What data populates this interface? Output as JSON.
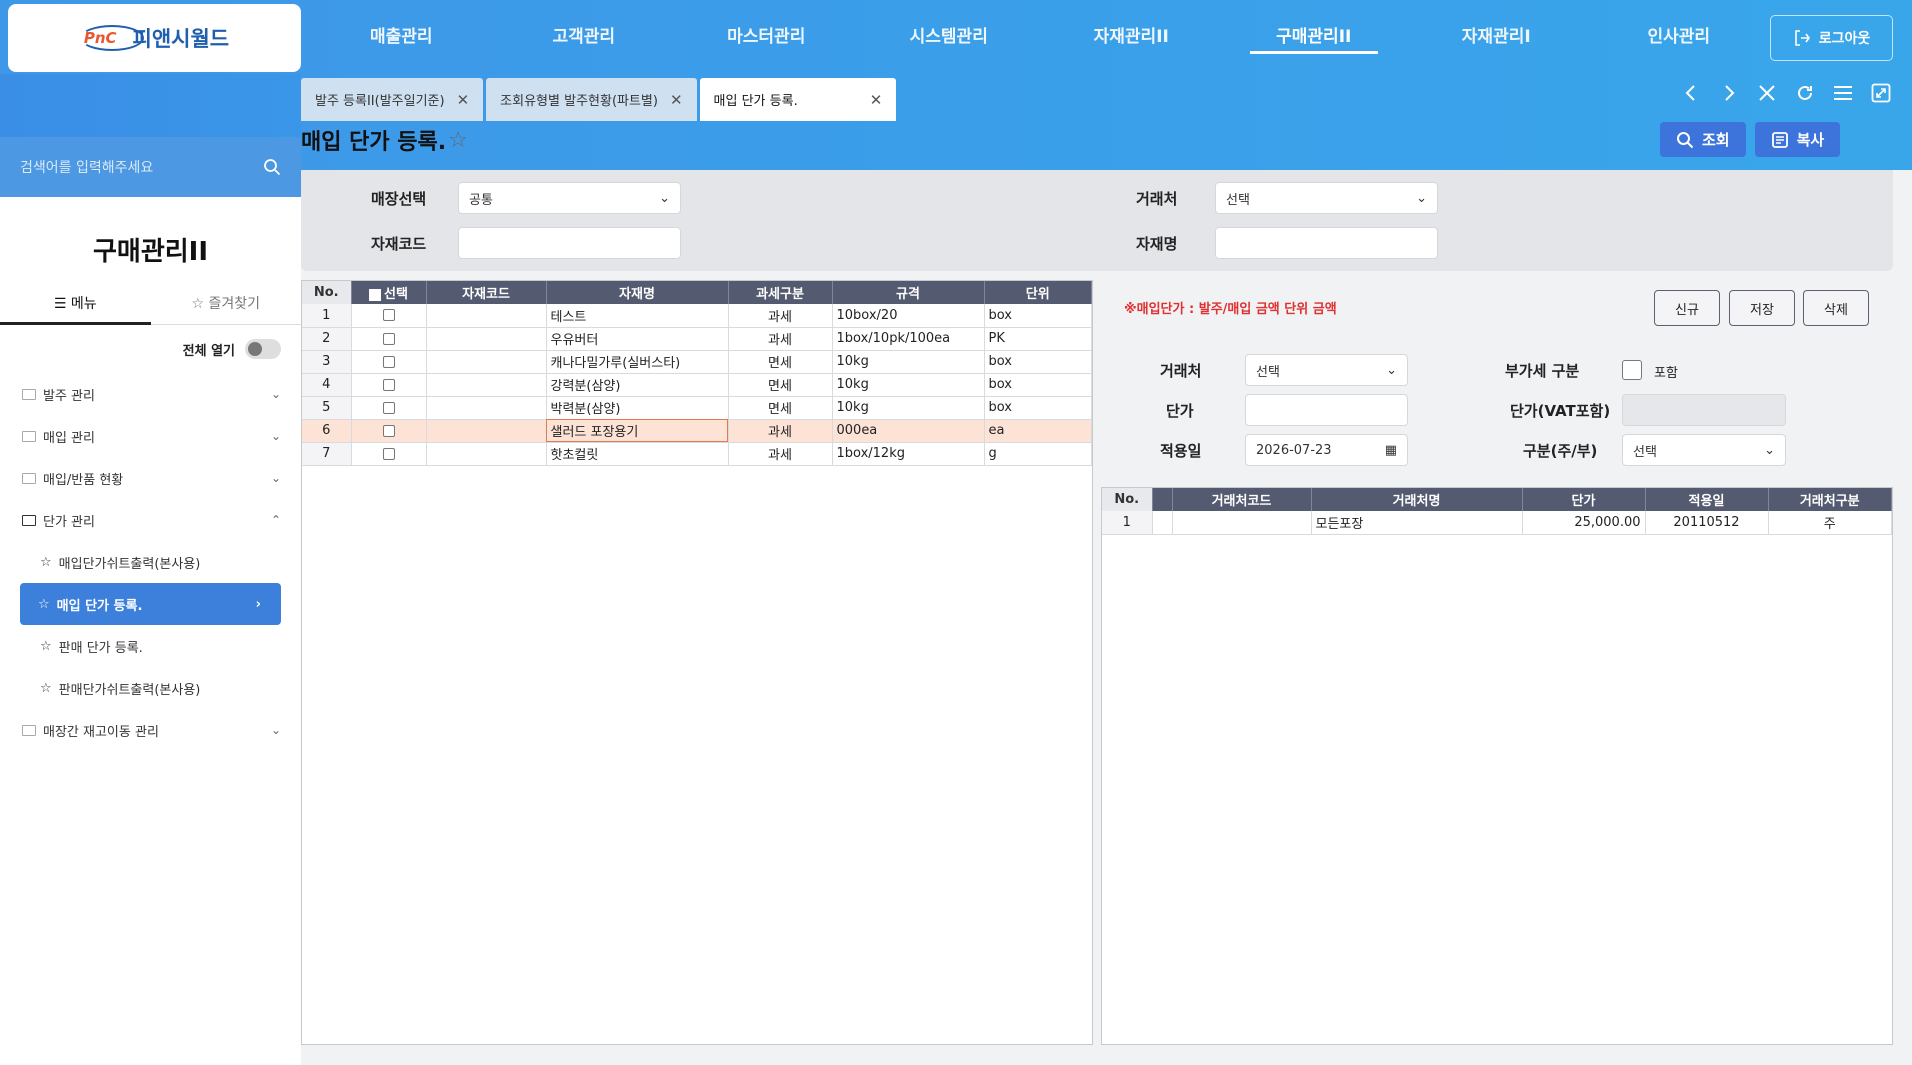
{
  "logo": {
    "mark": "PnC",
    "name": "피앤시월드"
  },
  "gnb": {
    "items": [
      "매출관리",
      "고객관리",
      "마스터관리",
      "시스템관리",
      "자재관리II",
      "구매관리II",
      "자재관리I",
      "인사관리"
    ],
    "active": "구매관리II",
    "logout": "로그아웃"
  },
  "tabs": [
    {
      "label": "발주 등록II(발주일기준)"
    },
    {
      "label": "조회유형별 발주현황(파트별)"
    },
    {
      "label": "매입 단가 등록."
    }
  ],
  "page": {
    "title": "매입 단가 등록.",
    "search_btn": "조회",
    "copy_btn": "복사"
  },
  "sidebar": {
    "search_placeholder": "검색어를 입력해주세요",
    "title": "구매관리II",
    "tab_menu": "메뉴",
    "tab_fav": "즐겨찾기",
    "open_all": "전체 열기",
    "items": [
      {
        "label": "발주 관리"
      },
      {
        "label": "매입 관리"
      },
      {
        "label": "매입/반품 현황"
      },
      {
        "label": "단가 관리"
      },
      {
        "label": "매입단가쉬트출력(본사용)"
      },
      {
        "label": "매입 단가 등록."
      },
      {
        "label": "판매 단가 등록."
      },
      {
        "label": "판매단가쉬트출력(본사용)"
      },
      {
        "label": "매장간 재고이동 관리"
      }
    ]
  },
  "filters": {
    "store_label": "매장선택",
    "store_value": "공통",
    "vendor_label": "거래처",
    "vendor_value": "선택",
    "code_label": "자재코드",
    "name_label": "자재명"
  },
  "left_grid": {
    "headers": [
      "No.",
      "선택",
      "자재코드",
      "자재명",
      "과세구분",
      "규격",
      "단위"
    ],
    "rows": [
      {
        "no": "1",
        "code": "",
        "name": "테스트",
        "tax": "과세",
        "spec": "10box/20",
        "unit": "box"
      },
      {
        "no": "2",
        "code": "",
        "name": "우유버터",
        "tax": "과세",
        "spec": "1box/10pk/100ea",
        "unit": "PK"
      },
      {
        "no": "3",
        "code": "",
        "name": "캐나다밀가루(실버스타)",
        "tax": "면세",
        "spec": "10kg",
        "unit": "box"
      },
      {
        "no": "4",
        "code": "",
        "name": "강력분(삼양)",
        "tax": "면세",
        "spec": "10kg",
        "unit": "box"
      },
      {
        "no": "5",
        "code": "",
        "name": "박력분(삼양)",
        "tax": "면세",
        "spec": "10kg",
        "unit": "box"
      },
      {
        "no": "6",
        "code": "",
        "name": "샐러드 포장용기",
        "tax": "과세",
        "spec": "000ea",
        "unit": "ea"
      },
      {
        "no": "7",
        "code": "",
        "name": "핫초컬릿",
        "tax": "과세",
        "spec": "1box/12kg",
        "unit": "g"
      }
    ]
  },
  "detail": {
    "notice": "※매입단가 : 발주/매입 금액 단위 금액",
    "new_btn": "신규",
    "save_btn": "저장",
    "delete_btn": "삭제",
    "vendor_label": "거래처",
    "vendor_value": "선택",
    "vat_label": "부가세 구분",
    "vat_option": "포함",
    "price_label": "단가",
    "price_vat_label": "단가(VAT포함)",
    "date_label": "적용일",
    "date_value": "2026-07-23",
    "kind_label": "구분(주/부)",
    "kind_value": "선택"
  },
  "right_grid": {
    "headers": [
      "No.",
      "",
      "거래처코드",
      "거래처명",
      "단가",
      "적용일",
      "거래처구분"
    ],
    "rows": [
      {
        "no": "1",
        "code": "",
        "name": "모든포장",
        "price": "25,000.00",
        "date": "20110512",
        "kind": "주"
      }
    ]
  }
}
